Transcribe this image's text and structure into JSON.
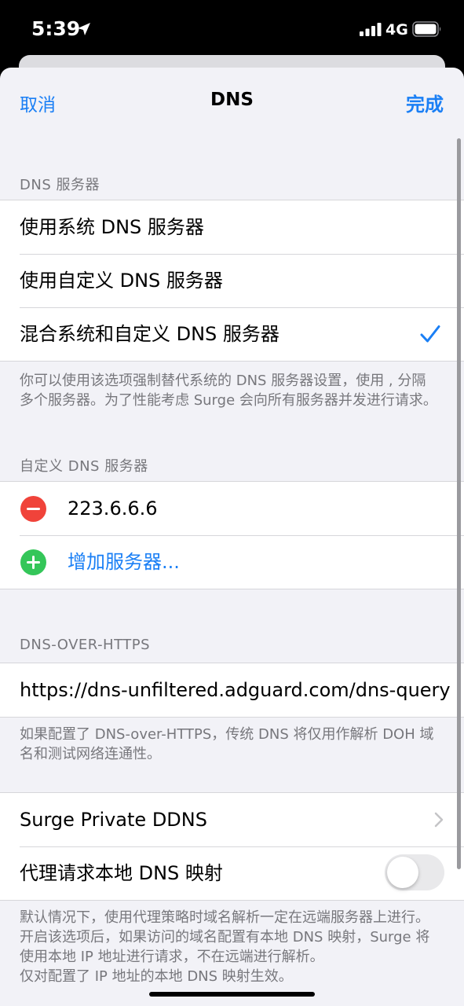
{
  "status_bar": {
    "time": "5:39",
    "network": "4G"
  },
  "nav": {
    "cancel": "取消",
    "title": "DNS",
    "done": "完成"
  },
  "dns_servers": {
    "header": "DNS 服务器",
    "options": [
      {
        "label": "使用系统 DNS 服务器",
        "selected": false
      },
      {
        "label": "使用自定义 DNS 服务器",
        "selected": false
      },
      {
        "label": "混合系统和自定义 DNS 服务器",
        "selected": true
      }
    ],
    "footer": "你可以使用该选项强制替代系统的 DNS 服务器设置，使用 , 分隔多个服务器。为了性能考虑 Surge 会向所有服务器并发进行请求。"
  },
  "custom_dns": {
    "header": "自定义 DNS 服务器",
    "servers": [
      "223.6.6.6"
    ],
    "add_label": "增加服务器..."
  },
  "doh": {
    "header": "DNS-OVER-HTTPS",
    "url": "https://dns-unfiltered.adguard.com/dns-query",
    "footer": "如果配置了 DNS-over-HTTPS，传统 DNS 将仅用作解析 DOH 域名和测试网络连通性。"
  },
  "extra": {
    "private_ddns_label": "Surge Private DDNS",
    "proxy_local_mapping_label": "代理请求本地 DNS 映射",
    "proxy_local_mapping_enabled": false,
    "footer_1": "默认情况下，使用代理策略时域名解析一定在远端服务器上进行。",
    "footer_2": "开启该选项后，如果访问的域名配置有本地 DNS 映射，Surge 将使用本地 IP 地址进行请求，不在远端进行解析。",
    "footer_3": "仅对配置了 IP 地址的本地 DNS 映射生效。"
  },
  "colors": {
    "accent": "#1a7ff5",
    "remove": "#f0433a",
    "add": "#34c659",
    "background": "#f2f2f7"
  }
}
